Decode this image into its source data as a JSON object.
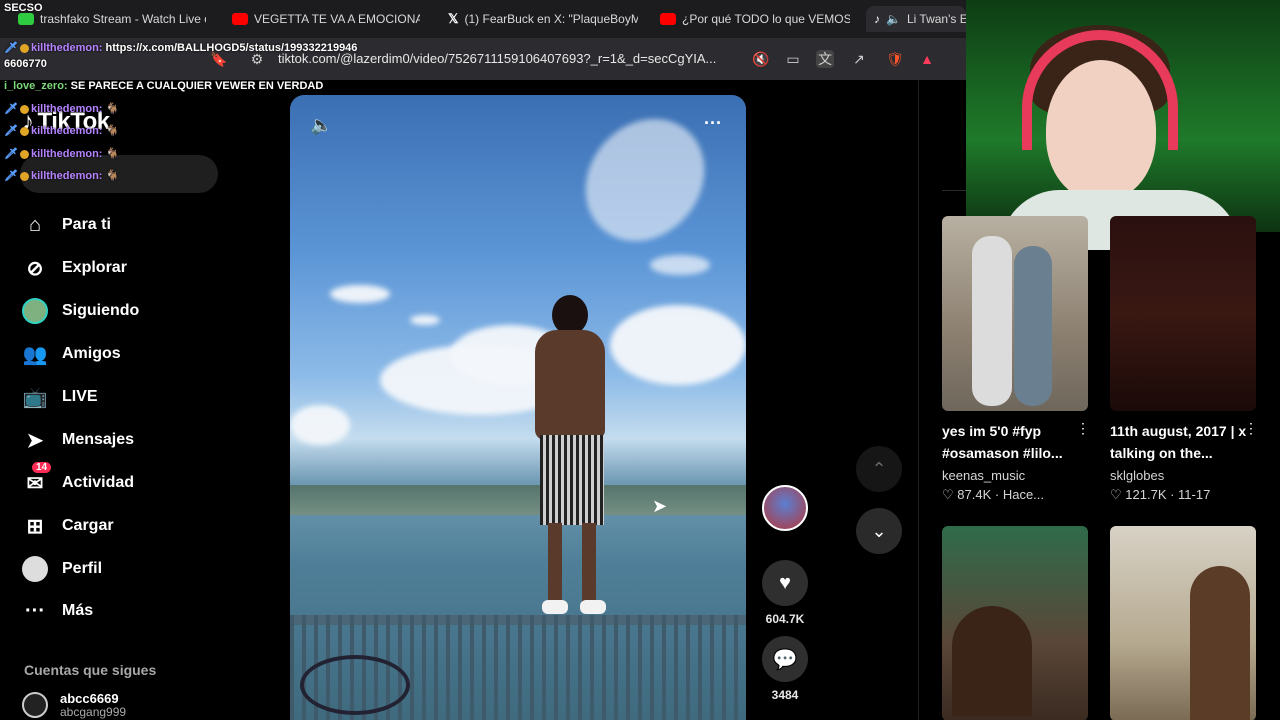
{
  "browser": {
    "tabs": [
      {
        "icon": "twitch-icon",
        "title": "trashfako Stream - Watch Live o"
      },
      {
        "icon": "youtube-icon",
        "title": "VEGETTA TE VA A EMOCIONAR"
      },
      {
        "icon": "x-icon",
        "title": "(1) FearBuck en X: \"PlaqueBoyM"
      },
      {
        "icon": "youtube-icon",
        "title": "¿Por qué TODO lo que VEMOS e"
      },
      {
        "icon": "tiktok-icon",
        "title": "Li Twan's E"
      }
    ],
    "url": "tiktok.com/@lazerdim0/video/7526711159106407693?_r=1&_d=secCgYIA..."
  },
  "chat": {
    "header": "SECSO",
    "lines": [
      {
        "user": "killthedemon:",
        "message": "https://x.com/BALLHOGD5/status/199332219946"
      },
      {
        "user": "",
        "message": "6606770"
      },
      {
        "user": "i_love_zero:",
        "message": "SE PARECE A CUALQUIER VEWER EN VERDAD"
      },
      {
        "user": "killthedemon:",
        "message": "🐐"
      },
      {
        "user": "killthedemon:",
        "message": "🐐"
      },
      {
        "user": "killthedemon:",
        "message": "🐐"
      },
      {
        "user": "killthedemon:",
        "message": "🐐"
      }
    ]
  },
  "sidebar": {
    "logo": "TikTok",
    "items": [
      {
        "label": "Para ti",
        "icon": "home-icon"
      },
      {
        "label": "Explorar",
        "icon": "compass-icon"
      },
      {
        "label": "Siguiendo",
        "icon": "following-avatar-icon"
      },
      {
        "label": "Amigos",
        "icon": "friends-icon"
      },
      {
        "label": "LIVE",
        "icon": "live-icon"
      },
      {
        "label": "Mensajes",
        "icon": "send-icon"
      },
      {
        "label": "Actividad",
        "icon": "inbox-icon",
        "badge": "14"
      },
      {
        "label": "Cargar",
        "icon": "plus-square-icon"
      },
      {
        "label": "Perfil",
        "icon": "profile-avatar-icon"
      },
      {
        "label": "Más",
        "icon": "more-icon"
      }
    ],
    "following_title": "Cuentas que sigues",
    "following": [
      {
        "name": "abcc6669",
        "handle": "abcgang999"
      }
    ]
  },
  "video": {
    "likes": "604.7K",
    "comments": "3484"
  },
  "recommendations": [
    {
      "caption": "yes im 5'0 #fyp #osamason #lilo...",
      "author": "keenas_music",
      "likes": "87.4K",
      "time": "Hace..."
    },
    {
      "caption": "11th august, 2017 | x talking on the...",
      "author": "sklglobes",
      "likes": "121.7K",
      "time": "11-17"
    }
  ],
  "colors": {
    "accent": "#fe2c55",
    "chat_user": "#b583ff",
    "background": "#000000"
  }
}
